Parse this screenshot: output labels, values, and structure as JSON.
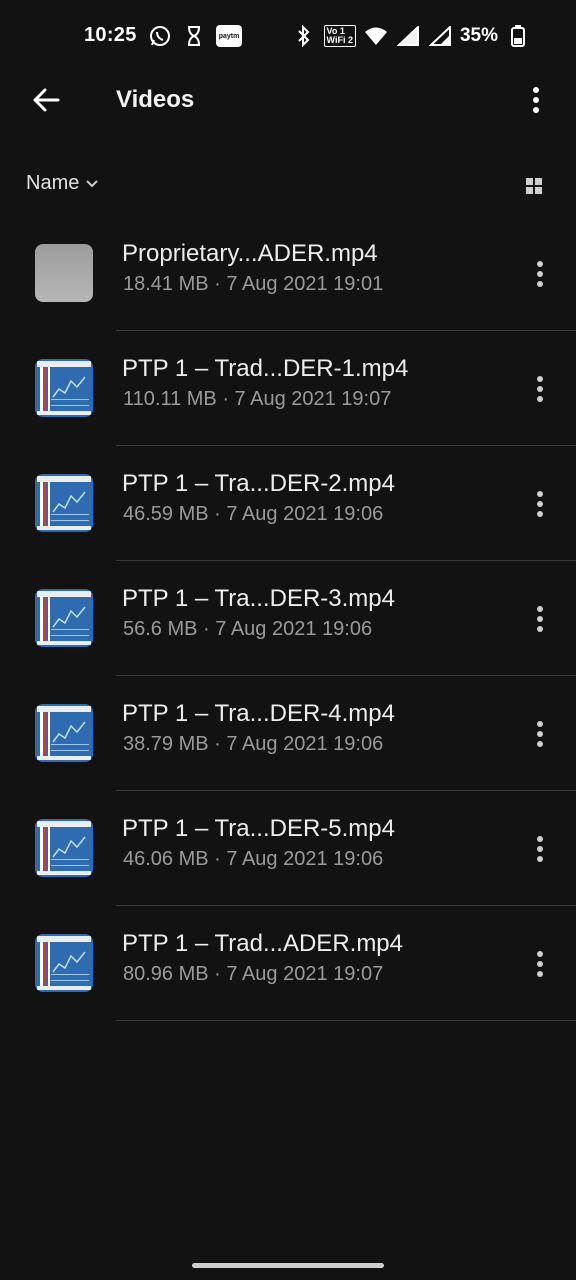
{
  "status_bar": {
    "time": "10:25",
    "battery": "35%",
    "left_icons": [
      "whatsapp-icon",
      "hourglass-icon",
      "paytm-icon"
    ],
    "right_icons": [
      "bluetooth-icon",
      "volte-wifi-icon",
      "wifi-icon",
      "signal-icon",
      "signal-icon",
      "battery-icon"
    ],
    "paytm_label": "paytm",
    "volte_line1": "Vo 1",
    "volte_line2": "WiFi 2"
  },
  "app_bar": {
    "title": "Videos"
  },
  "sort": {
    "label": "Name"
  },
  "files": [
    {
      "name": "Proprietary...ADER.mp4",
      "meta": "18.41 MB · 7 Aug 2021 19:01",
      "thumb": "gray"
    },
    {
      "name": "PTP 1 – Trad...DER-1.mp4",
      "meta": "110.11 MB · 7 Aug 2021 19:07",
      "thumb": "video"
    },
    {
      "name": "PTP 1 – Tra...DER-2.mp4",
      "meta": "46.59 MB · 7 Aug 2021 19:06",
      "thumb": "video"
    },
    {
      "name": "PTP 1 – Tra...DER-3.mp4",
      "meta": "56.6 MB · 7 Aug 2021 19:06",
      "thumb": "video"
    },
    {
      "name": "PTP 1 – Tra...DER-4.mp4",
      "meta": "38.79 MB · 7 Aug 2021 19:06",
      "thumb": "video"
    },
    {
      "name": "PTP 1 – Tra...DER-5.mp4",
      "meta": "46.06 MB · 7 Aug 2021 19:06",
      "thumb": "video"
    },
    {
      "name": "PTP 1 – Trad...ADER.mp4",
      "meta": "80.96 MB · 7 Aug 2021 19:07",
      "thumb": "video"
    }
  ],
  "colors": {
    "background": "#121212",
    "text_primary": "#ededed",
    "text_secondary": "#9a9a9a",
    "divider": "#3a3a3a"
  }
}
